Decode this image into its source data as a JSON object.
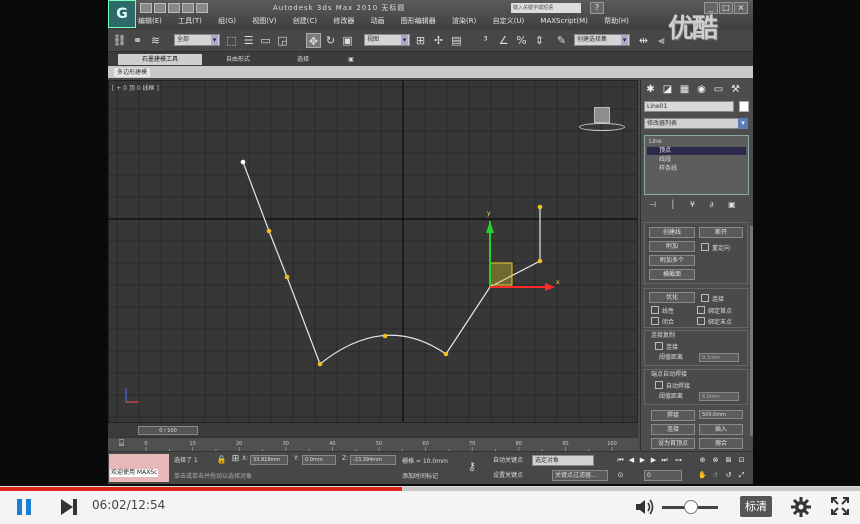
{
  "window": {
    "title": "Autodesk 3ds Max  2010   无标题",
    "search_placeholder": "键入关键字或短语",
    "menus": [
      "编辑(E)",
      "工具(T)",
      "组(G)",
      "视图(V)",
      "创建(C)",
      "修改器",
      "动画",
      "图形编辑器",
      "渲染(R)",
      "自定义(U)",
      "MAXScript(M)",
      "帮助(H)"
    ]
  },
  "toolbar": {
    "selection_filter": "全部",
    "reference_coord": "视图",
    "named_selection": "创建选择集"
  },
  "ribbon": {
    "tabs": [
      "石墨建模工具",
      "自由形式",
      "选择",
      "▣"
    ],
    "sub_label": "多边形建模"
  },
  "viewport": {
    "label": "[ + 0 顶 0 线框 ]",
    "gizmo_x_label": "x",
    "gizmo_y_label": "y"
  },
  "command_panel": {
    "object_name": "Line01",
    "modifier_list": "修改器列表",
    "stack": [
      "Line",
      "顶点",
      "线段",
      "样条线"
    ],
    "stack_tools": "⊣ │ ¥ ∂ ▣",
    "geometry_buttons": {
      "create_line": "创建线",
      "break": "断开",
      "attach": "附加",
      "reorient": "重定向",
      "attach_mult": "附加多个",
      "cross_section": "横截面"
    },
    "refine": "优化",
    "connect": "连接",
    "linear": "线性",
    "bind_first": "绑定首点",
    "closed": "闭合",
    "bind_last": "绑定末点",
    "connect_copy": "连接复制",
    "connect_copy_check": "连接",
    "threshold_label": "阈值距离",
    "threshold_value": "0.1mm",
    "end_auto_weld": "端点自动焊接",
    "auto_weld": "自动焊接",
    "weld_threshold_value": "6.0mm",
    "weld": "焊接",
    "weld_value": "500.0mm",
    "connect_btn": "连接",
    "insert": "插入",
    "set_first": "设为首顶点",
    "fuse": "熔合"
  },
  "timeline": {
    "frame_readout": "0 / 100",
    "ticks": [
      "0",
      "10",
      "20",
      "30",
      "40",
      "50",
      "60",
      "70",
      "80",
      "90",
      "100"
    ]
  },
  "status": {
    "maxscript_label": "欢迎使用 MAXSc",
    "selected": "选择了 1",
    "prompt": "单击或单击并拖动以选择对象",
    "x_label": "X:",
    "x_value": "33.818mm",
    "y_label": "Y:",
    "y_value": "0.0mm",
    "z_label": "Z:",
    "z_value": "-23.394mm",
    "grid": "栅格 = 10.0mm",
    "add_time_tag": "添加时间标记",
    "auto_key": "自动关键点",
    "selected_dd": "选定对象",
    "set_key": "设置关键点",
    "key_filters": "关键点过滤器...",
    "frame": "0"
  },
  "player": {
    "time": "06:02/12:54",
    "quality": "标清",
    "progress": 0.467
  },
  "watermark": "优酷"
}
